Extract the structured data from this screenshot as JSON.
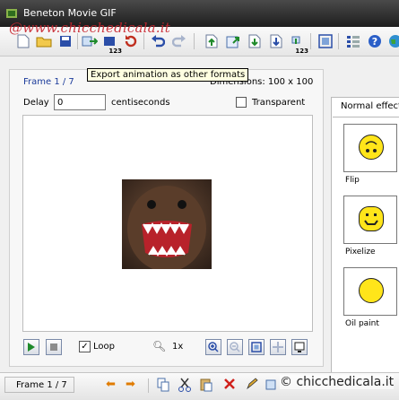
{
  "window": {
    "title": "Beneton Movie GIF"
  },
  "watermark": {
    "top": "@www.chicchedicala.it",
    "bottom": "© chicchedicala.it"
  },
  "toolbar": {
    "badge_123": "123",
    "badge_123b": "123",
    "icons": [
      "new-icon",
      "open-icon",
      "save-icon",
      "export-icon",
      "save-frames-icon",
      "refresh-icon",
      "undo-icon",
      "redo-icon",
      "insert-frame-icon",
      "import-frame-icon",
      "export-frame-icon",
      "move-frame-icon",
      "number-frames-icon",
      "fit-icon",
      "list-icon",
      "help-icon",
      "web-icon"
    ]
  },
  "tooltip": {
    "text": "Export animation as other formats"
  },
  "frame": {
    "label": "Frame 1 / 7",
    "dimensions": "Dimensions: 100 x 100",
    "delay_label": "Delay",
    "delay_value": "0",
    "delay_unit": "centiseconds",
    "transparent_label": "Transparent",
    "transparent_checked": false
  },
  "playback": {
    "loop_label": "Loop",
    "loop_checked": true,
    "zoom": "1x"
  },
  "effects": {
    "tab_label": "Normal effects",
    "items": [
      {
        "label": "Flip"
      },
      {
        "label": "Pixelize"
      },
      {
        "label": "Oil paint"
      }
    ]
  },
  "statusbar": {
    "frame": "Frame 1 / 7"
  },
  "colors": {
    "accent": "#1a3a9a",
    "smiley": "#ffe51a",
    "watermark": "#c8262f"
  }
}
